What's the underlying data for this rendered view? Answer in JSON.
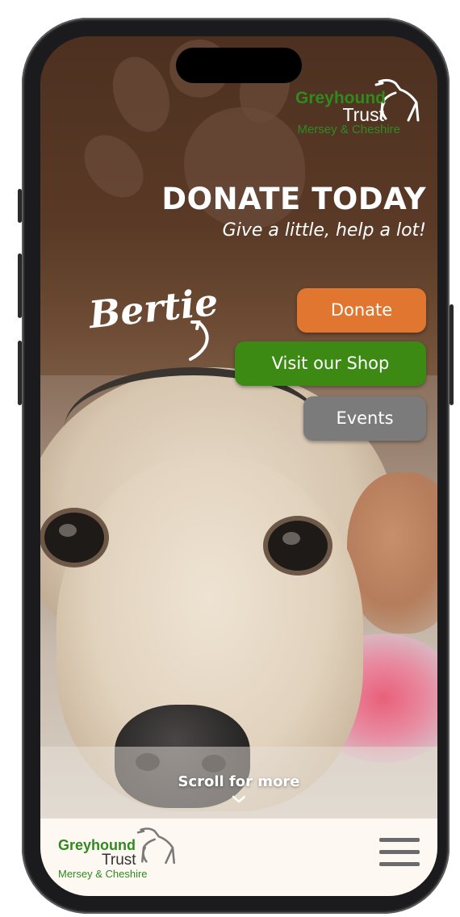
{
  "header": {
    "logo": {
      "line1": "Greyhound",
      "line2": "Trust",
      "line3": "Mersey & Cheshire"
    },
    "headline": "DONATE TODAY",
    "tagline": "Give a little, help a lot!"
  },
  "hero": {
    "dog_name": "Bertie"
  },
  "actions": [
    {
      "label": "Donate",
      "color": "#e0762f"
    },
    {
      "label": "Visit our Shop",
      "color": "#3c8a14"
    },
    {
      "label": "Events",
      "color": "#7b7b7b"
    }
  ],
  "scroll_hint": {
    "label": "Scroll for more",
    "icon": "chevron-down-icon"
  },
  "footer": {
    "logo": {
      "line1": "Greyhound",
      "line2": "Trust",
      "line3": "Mersey & Cheshire"
    },
    "menu_icon": "hamburger-menu-icon"
  }
}
